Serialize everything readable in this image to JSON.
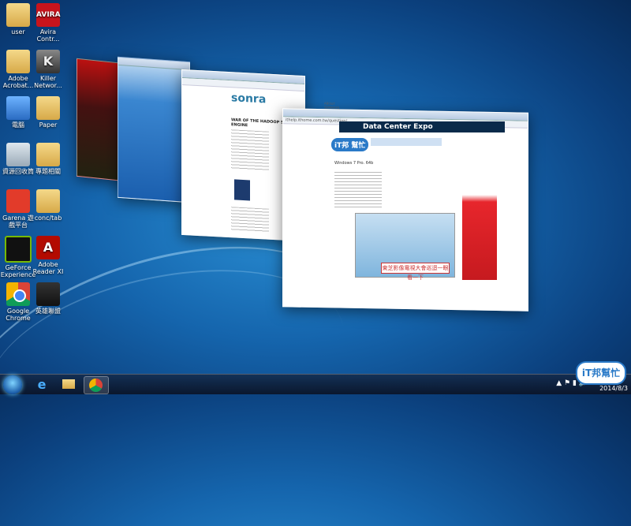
{
  "desktop_icons": [
    {
      "label": "user",
      "kind": "folder"
    },
    {
      "label": "Avira Contr...",
      "kind": "avira",
      "glyph": "AVIRA"
    },
    {
      "label": "Adobe Acrobat...",
      "kind": "folder"
    },
    {
      "label": "Killer Networ...",
      "kind": "killer",
      "glyph": "K"
    },
    {
      "label": "電腦",
      "kind": "pc"
    },
    {
      "label": "Paper",
      "kind": "folder"
    },
    {
      "label": "資源回收筒",
      "kind": "bin"
    },
    {
      "label": "專題相關",
      "kind": "folder"
    },
    {
      "label": "Garena 遊戲平台",
      "kind": "garena"
    },
    {
      "label": "conc/tab",
      "kind": "folder"
    },
    {
      "label": "GeForce Experience",
      "kind": "nvidia"
    },
    {
      "label": "Adobe Reader XI",
      "kind": "acro",
      "glyph": "A"
    },
    {
      "label": "Google Chrome",
      "kind": "chrome"
    },
    {
      "label": "英雄聯盟",
      "kind": "game"
    }
  ],
  "windows": {
    "sonra": {
      "logo": "sonra",
      "nav": "ABOUT   SERVICES   WHITE PAPERS   CONTACT",
      "headline": "WAR OF THE HADOOP SQL ENGINE"
    },
    "ithome": {
      "url": "ithelp.ithome.com.tw/question/...",
      "banner": "Data Center Expo",
      "logo": "iT邦 幫忙",
      "body_line": "Windows 7 Pro. 64b",
      "image_caption": "東芝影像電視大會巡迴一眼看一下"
    }
  },
  "taskbar": {
    "ie_glyph": "e",
    "tray": "▲ ⚑ ▮ 🔊",
    "date": "2014/8/3"
  },
  "watermark": "iT邦幫忙"
}
